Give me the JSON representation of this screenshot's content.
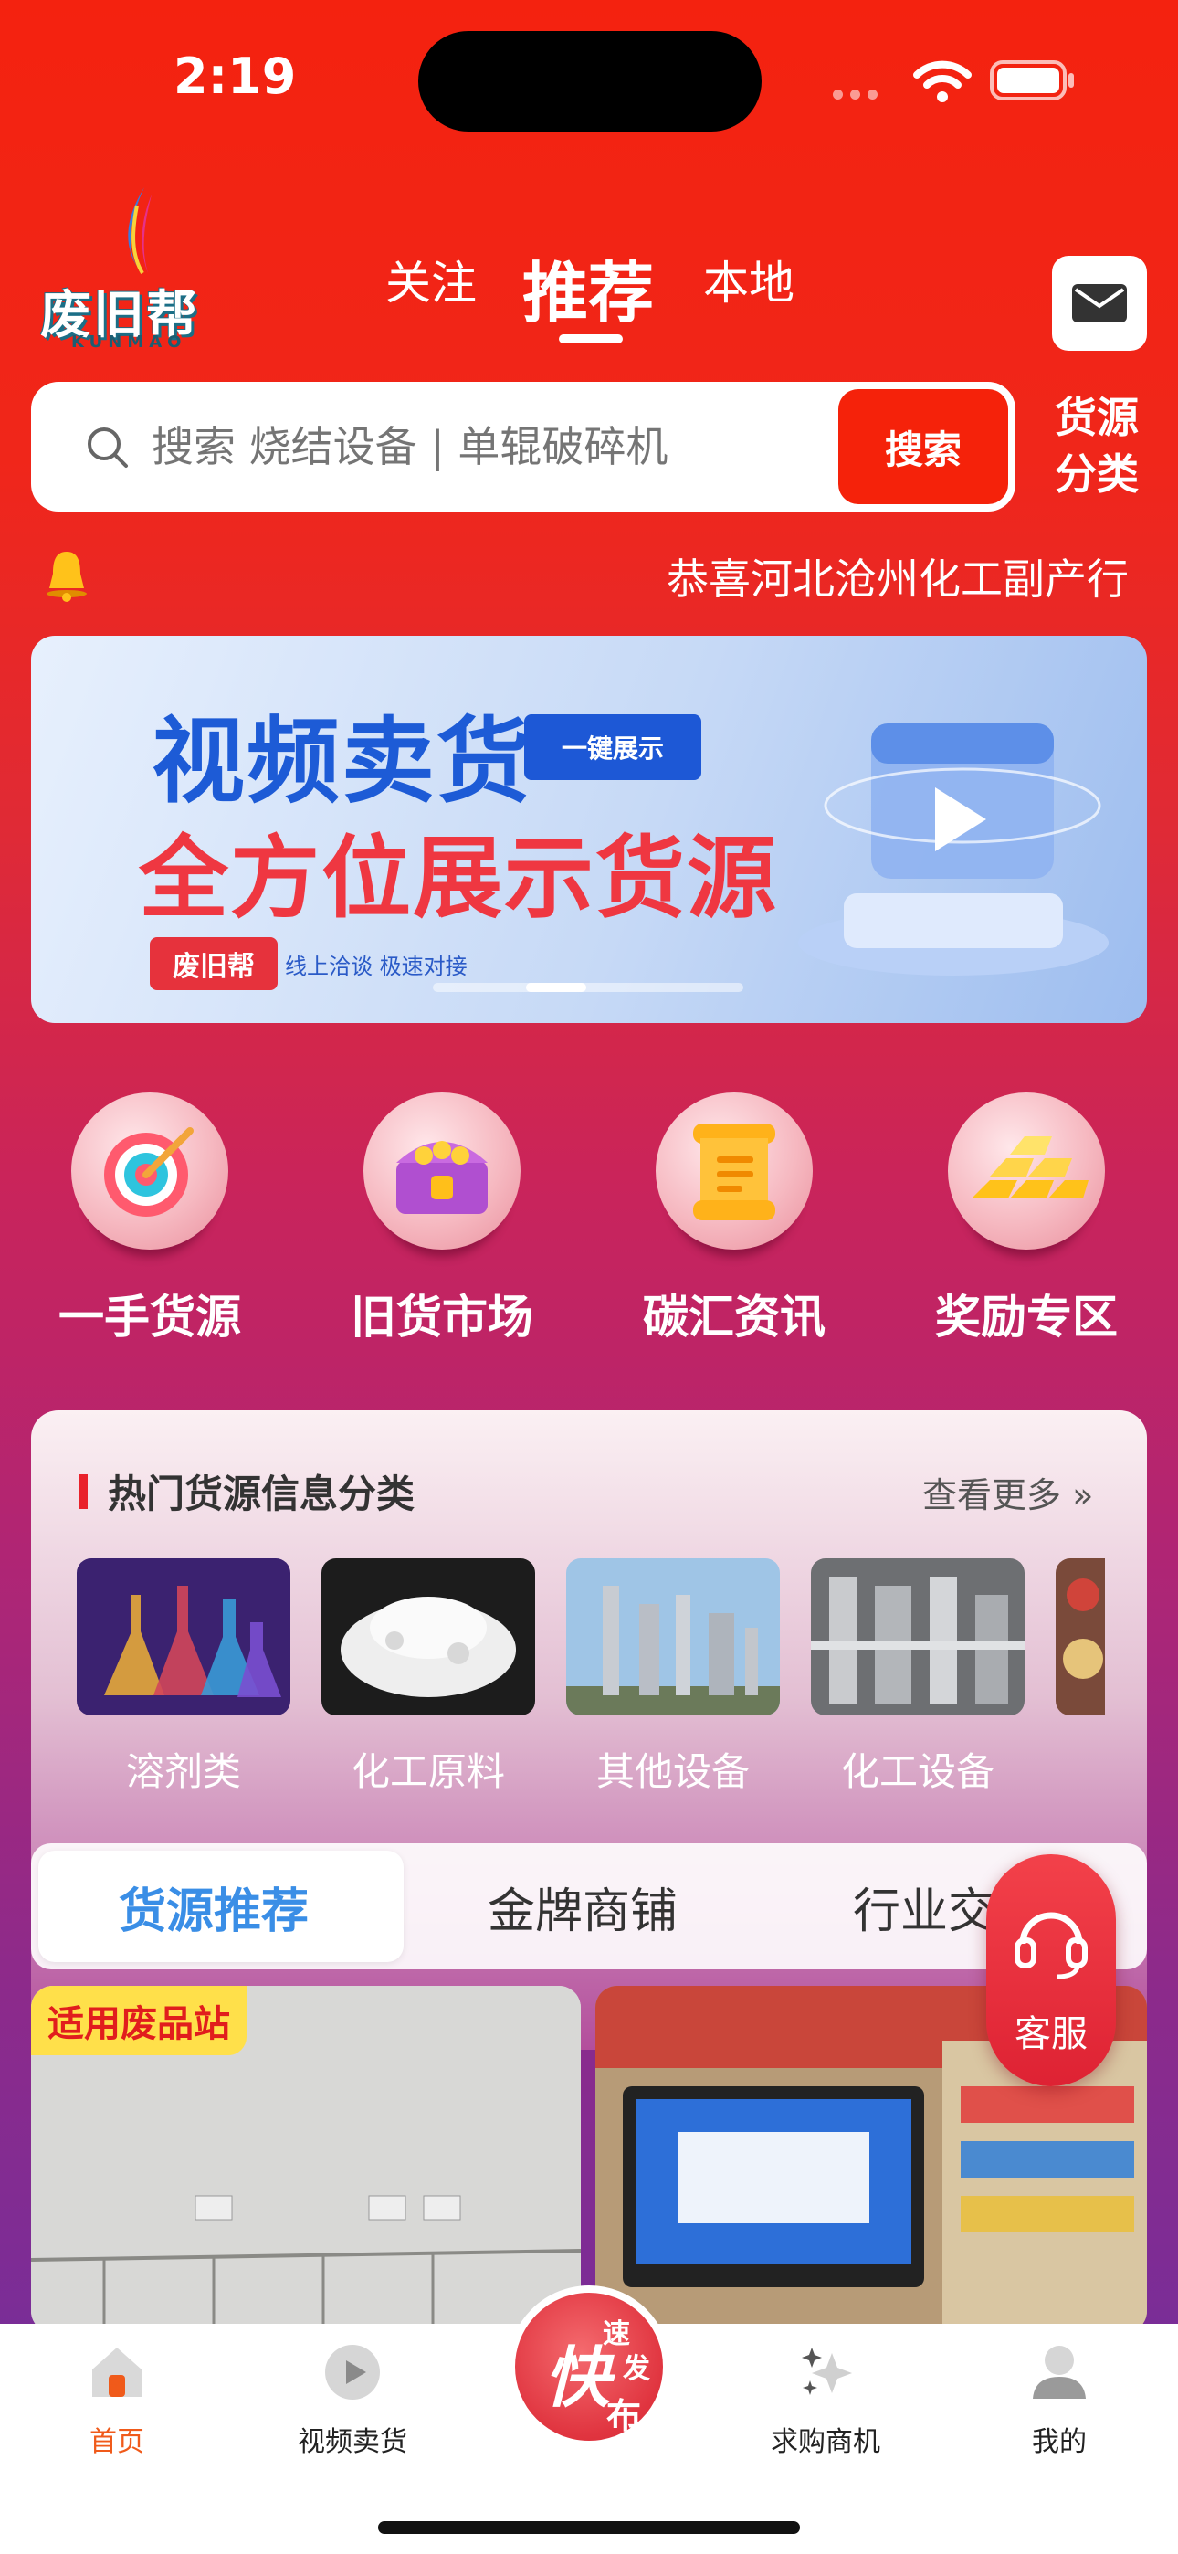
{
  "status": {
    "time": "2:19"
  },
  "header": {
    "logo_text": "废旧帮",
    "logo_sub": "KUNMAO",
    "tabs": [
      "关注",
      "推荐",
      "本地"
    ],
    "active_tab": "推荐"
  },
  "search": {
    "placeholder": "搜索 烧结设备 | 单辊破碎机",
    "button": "搜索",
    "category_button": [
      "货源",
      "分类"
    ]
  },
  "notice": {
    "text": "恭喜河北沧州化工副产行"
  },
  "banner": {
    "title": "视频卖货",
    "tag": "一键展示",
    "subtitle": "全方位展示货源",
    "brand": "废旧帮",
    "slogan": "线上洽谈  极速对接"
  },
  "shortcuts": [
    {
      "label": "一手货源",
      "icon": "target-icon"
    },
    {
      "label": "旧货市场",
      "icon": "treasure-chest-icon"
    },
    {
      "label": "碳汇资讯",
      "icon": "scroll-icon"
    },
    {
      "label": "奖励专区",
      "icon": "gold-bars-icon"
    }
  ],
  "hot_categories": {
    "title": "热门货源信息分类",
    "more": "查看更多 »",
    "items": [
      {
        "name": "溶剂类",
        "icon": "flasks-image"
      },
      {
        "name": "化工原料",
        "icon": "white-flakes-image"
      },
      {
        "name": "其他设备",
        "icon": "refinery-image"
      },
      {
        "name": "化工设备",
        "icon": "pipes-equipment-image"
      }
    ]
  },
  "content_tabs": {
    "items": [
      "货源推荐",
      "金牌商铺",
      "行业交"
    ],
    "active": "货源推荐"
  },
  "cards": [
    {
      "tag": "适用废品站"
    },
    {
      "tag": ""
    }
  ],
  "customer_service": {
    "label": "客服"
  },
  "bottom_nav": {
    "items": [
      {
        "label": "首页",
        "icon": "home-icon"
      },
      {
        "label": "视频卖货",
        "icon": "play-icon"
      },
      {
        "label": "求购商机",
        "icon": "sparkle-icon"
      },
      {
        "label": "我的",
        "icon": "user-icon"
      }
    ],
    "center": {
      "big": "快",
      "small_top": "速",
      "small_mid": "发",
      "small_bottom": "布"
    },
    "active": "首页"
  },
  "colors": {
    "accent": "#f5220a",
    "active_tab_text": "#3a8ee6",
    "nav_active": "#f05a1a"
  }
}
